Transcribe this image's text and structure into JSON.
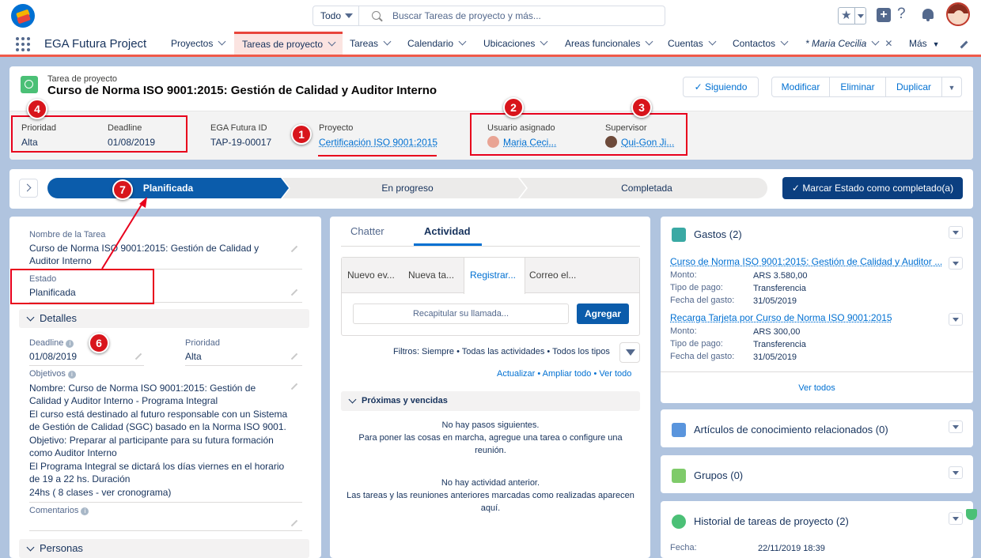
{
  "global_header": {
    "search_scope": "Todo",
    "search_placeholder": "Buscar Tareas de proyecto y más..."
  },
  "nav": {
    "app_name": "EGA Futura Project",
    "items": [
      "Proyectos",
      "Tareas de proyecto",
      "Tareas",
      "Calendario",
      "Ubicaciones",
      "Areas funcionales",
      "Cuentas",
      "Contactos",
      "* Maria Cecilia",
      "Más"
    ]
  },
  "record": {
    "object_type": "Tarea de proyecto",
    "title": "Curso de Norma ISO 9001:2015: Gestión de Calidad y Auditor Interno",
    "follow_label": "Siguiendo",
    "actions": [
      "Modificar",
      "Eliminar",
      "Duplicar"
    ],
    "highlights": {
      "priority_label": "Prioridad",
      "priority": "Alta",
      "deadline_label": "Deadline",
      "deadline": "01/08/2019",
      "id_label": "EGA Futura ID",
      "id": "TAP-19-00017",
      "project_label": "Proyecto",
      "project": "Certificación ISO 9001:2015",
      "assignee_label": "Usuario asignado",
      "assignee": "Maria Ceci...",
      "supervisor_label": "Supervisor",
      "supervisor": "Qui-Gon Ji..."
    }
  },
  "annotations": [
    "1",
    "2",
    "3",
    "4",
    "6",
    "7"
  ],
  "path": {
    "stages": [
      "Planificada",
      "En progreso",
      "Completada"
    ],
    "current": "Planificada",
    "complete_button": "Marcar Estado como completado(a)"
  },
  "details": {
    "name_label": "Nombre de la Tarea",
    "name_value": "Curso de Norma ISO 9001:2015: Gestión de Calidad y Auditor Interno",
    "status_label": "Estado",
    "status_value": "Planificada",
    "section_details": "Detalles",
    "deadline_label": "Deadline",
    "deadline_value": "01/08/2019",
    "priority_label": "Prioridad",
    "priority_value": "Alta",
    "objectives_label": "Objetivos",
    "objectives_lines": [
      "Nombre: Curso de Norma ISO 9001:2015: Gestión de",
      "Calidad y Auditor Interno - Programa Integral",
      "El curso está destinado al futuro responsable con un Sistema",
      "de Gestión de Calidad (SGC) basado en la Norma ISO 9001.",
      "Objetivo: Preparar al participante para su futura formación",
      "como Auditor Interno",
      "El Programa Integral se dictará los días viernes en el horario",
      "de 19 a 22 hs. Duración",
      "24hs ( 8 clases - ver cronograma)"
    ],
    "comments_label": "Comentarios",
    "section_people": "Personas"
  },
  "activity": {
    "tabs": [
      "Chatter",
      "Actividad"
    ],
    "subtabs": [
      "Nuevo ev...",
      "Nueva ta...",
      "Registrar...",
      "Correo el..."
    ],
    "call_placeholder": "Recapitular su llamada...",
    "add_button": "Agregar",
    "filters": "Filtros: Siempre • Todas las actividades • Todos los tipos",
    "links": [
      "Actualizar",
      "Ampliar todo",
      "Ver todo"
    ],
    "upcoming_header": "Próximas y vencidas",
    "no_next_1": "No hay pasos siguientes.",
    "no_next_2": "Para poner las cosas en marcha, agregue una tarea o configure una",
    "no_next_3": "reunión.",
    "no_past_1": "No hay actividad anterior.",
    "no_past_2": "Las tareas y las reuniones anteriores marcadas como realizadas aparecen",
    "no_past_3": "aquí."
  },
  "related": {
    "expenses_title": "Gastos (2)",
    "expenses": [
      {
        "name": "Curso de Norma ISO 9001:2015: Gestión de Calidad y Auditor ...",
        "amount_label": "Monto:",
        "amount": "ARS 3.580,00",
        "payment_label": "Tipo de pago:",
        "payment": "Transferencia",
        "date_label": "Fecha del gasto:",
        "date": "31/05/2019"
      },
      {
        "name": "Recarga Tarjeta por Curso de Norma ISO 9001:2015",
        "amount_label": "Monto:",
        "amount": "ARS 300,00",
        "payment_label": "Tipo de pago:",
        "payment": "Transferencia",
        "date_label": "Fecha del gasto:",
        "date": "31/05/2019"
      }
    ],
    "view_all": "Ver todos",
    "knowledge_title": "Artículos de conocimiento relacionados (0)",
    "groups_title": "Grupos (0)",
    "history_title": "Historial de tareas de proyecto (2)",
    "history_date_label": "Fecha:",
    "history_date": "22/11/2019 18:39"
  },
  "colors": {
    "brand_blue": "#0070d2",
    "path_current": "#0b5cab",
    "annotation_red": "#d8151c",
    "nav_active": "#e8453c"
  }
}
